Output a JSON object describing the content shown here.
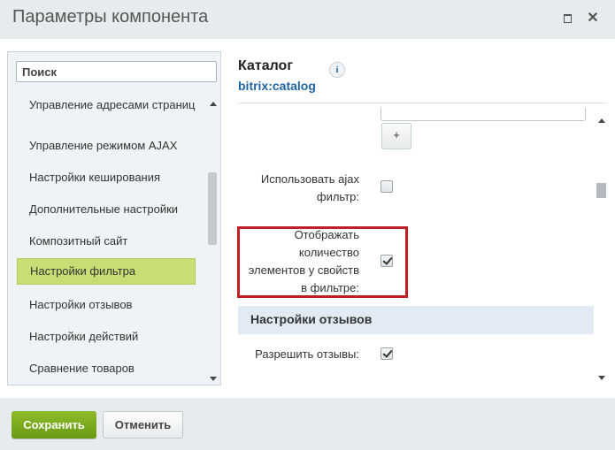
{
  "dialog": {
    "title": "Параметры компонента"
  },
  "sidebar": {
    "search_placeholder": "Поиск",
    "items": [
      {
        "label": "Управление адресами страниц"
      },
      {
        "label": "Управление режимом AJAX"
      },
      {
        "label": "Настройки кеширования"
      },
      {
        "label": "Дополнительные настройки"
      },
      {
        "label": "Композитный сайт"
      },
      {
        "label": "Настройки фильтра",
        "active": true
      },
      {
        "label": "Настройки отзывов"
      },
      {
        "label": "Настройки действий"
      },
      {
        "label": "Сравнение товаров"
      }
    ]
  },
  "component": {
    "name": "Каталог",
    "code": "bitrix:catalog",
    "info_icon": "i"
  },
  "params": {
    "plus_label": "+",
    "ajax_filter": {
      "label_line1": "Использовать ajax",
      "label_line2": "фильтр:",
      "checked": false
    },
    "show_count": {
      "label_line1": "Отображать",
      "label_line2": "количество",
      "label_line3": "элементов у свойств",
      "label_line4": "в фильтре:",
      "checked": true
    },
    "section_reviews": "Настройки отзывов",
    "allow_reviews": {
      "label": "Разрешить отзывы:",
      "checked": true
    }
  },
  "footer": {
    "save_label": "Сохранить",
    "cancel_label": "Отменить"
  },
  "colors": {
    "save_button": "#7aa81c",
    "active_item": "#c8de74",
    "highlight_border": "#c02025",
    "section_bg": "#e2ebf3",
    "link_blue": "#2066a6"
  }
}
